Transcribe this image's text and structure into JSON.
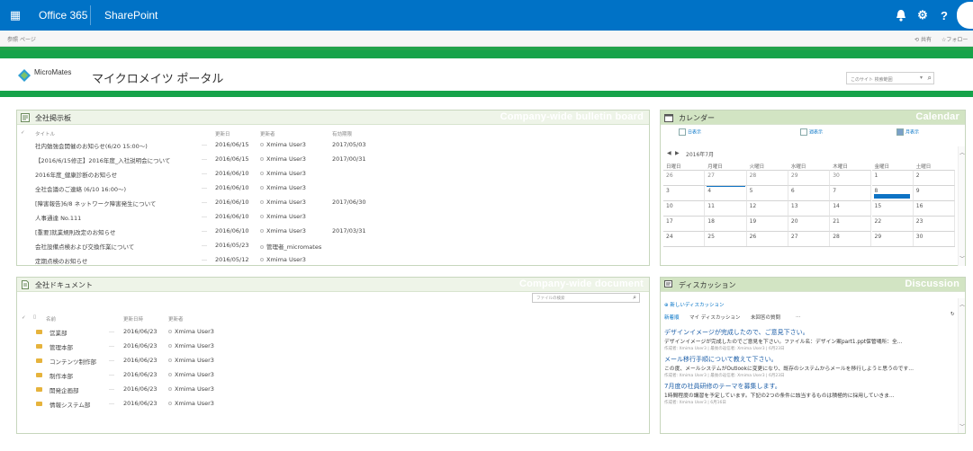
{
  "suite": {
    "office_label": "Office 365",
    "sharepoint_label": "SharePoint",
    "help_label": "?"
  },
  "ribbon": {
    "browse": "参照",
    "page": "ページ",
    "share": "共有",
    "follow": "フォロー"
  },
  "site": {
    "logo_text": "MicroMates",
    "title": "マイクロメイツ ポータル",
    "search_placeholder": "このサイト 検索範囲"
  },
  "bulletin": {
    "title": "全社掲示板",
    "watermark": "Company-wide bulletin board",
    "col_title": "タイトル",
    "col_modified": "更新日",
    "col_modified_by": "更新者",
    "col_expires": "有効期限",
    "rows": [
      {
        "title": "社内勉強会開催のお知らせ(6/20 15:00〜)",
        "date": "2016/06/15",
        "user": "Xmima User3",
        "expires": "2017/05/03"
      },
      {
        "title": "【2016/6/15修正】2016年度_入社説明会について",
        "date": "2016/06/15",
        "user": "Xmima User3",
        "expires": "2017/00/31"
      },
      {
        "title": "2016年度_健康診断のお知らせ",
        "date": "2016/06/10",
        "user": "Xmima User3",
        "expires": ""
      },
      {
        "title": "全社会議のご連絡 (6/10 16:00〜)",
        "date": "2016/06/10",
        "user": "Xmima User3",
        "expires": ""
      },
      {
        "title": "[障害報告]6/8 ネットワーク障害発生について",
        "date": "2016/06/10",
        "user": "Xmima User3",
        "expires": "2017/06/30"
      },
      {
        "title": "人事通達 No.111",
        "date": "2016/06/10",
        "user": "Xmima User3",
        "expires": ""
      },
      {
        "title": "[重要]就業規則改定のお知らせ",
        "date": "2016/06/10",
        "user": "Xmima User3",
        "expires": "2017/03/31"
      },
      {
        "title": "会社設備点検および交換作業について",
        "date": "2016/05/23",
        "user": "管理者_micromates",
        "expires": ""
      },
      {
        "title": "定期点検のお知らせ",
        "date": "2016/05/12",
        "user": "Xmima User3",
        "expires": ""
      }
    ]
  },
  "documents": {
    "title": "全社ドキュメント",
    "watermark": "Company-wide document",
    "search_placeholder": "ファイルの検索",
    "col_name": "名前",
    "col_modified": "更新日時",
    "col_modified_by": "更新者",
    "rows": [
      {
        "name": "営業部",
        "date": "2016/06/23",
        "user": "Xmima User3"
      },
      {
        "name": "管理本部",
        "date": "2016/06/23",
        "user": "Xmima User3"
      },
      {
        "name": "コンテンツ制作部",
        "date": "2016/06/23",
        "user": "Xmima User3"
      },
      {
        "name": "制作本部",
        "date": "2016/06/23",
        "user": "Xmima User3"
      },
      {
        "name": "開発企画部",
        "date": "2016/06/23",
        "user": "Xmima User3"
      },
      {
        "name": "情報システム部",
        "date": "2016/06/23",
        "user": "Xmima User3"
      }
    ]
  },
  "calendar": {
    "title": "カレンダー",
    "watermark": "Calendar",
    "view_day": "日表示",
    "view_week": "週表示",
    "view_month": "月表示",
    "month_label": "2016年7月",
    "weekdays": [
      "日曜日",
      "月曜日",
      "火曜日",
      "水曜日",
      "木曜日",
      "金曜日",
      "土曜日"
    ],
    "weeks": [
      [
        "26",
        "27",
        "28",
        "29",
        "30",
        "1",
        "2"
      ],
      [
        "3",
        "4",
        "5",
        "6",
        "7",
        "8",
        "9"
      ],
      [
        "10",
        "11",
        "12",
        "13",
        "14",
        "15",
        "16"
      ],
      [
        "17",
        "18",
        "19",
        "20",
        "21",
        "22",
        "23"
      ],
      [
        "24",
        "25",
        "26",
        "27",
        "28",
        "29",
        "30"
      ]
    ]
  },
  "discussion": {
    "title": "ディスカッション",
    "watermark": "Discussion",
    "new_label": "新しいディスカッション",
    "tab_latest": "新着順",
    "tab_mine": "マイ ディスカッション",
    "tab_unanswered": "未回答の質問",
    "tab_more": "…",
    "posts": [
      {
        "title": "デザインイメージが完成したので、ご意見下さい。",
        "body": "デザインイメージが完成したのでご意見を下さい。ファイル名：デザイン案part1.ppt保管場所：全…",
        "meta": "作成者: Xmima User3 | 最後の返信者: Xmima User3 | 6月23日"
      },
      {
        "title": "メール移行手順について教えて下さい。",
        "body": "この度、メールシステムがOutlookに変更になり、既存のシステムからメールを移行しようと思うのです…",
        "meta": "作成者: Xmima User3 | 最後の返信者: Xmima User3 | 6月23日"
      },
      {
        "title": "7月度の社員研修のテーマを募集します。",
        "body": "1時間程度の講習を予定しています。下記の2つの条件に該当するものは積極的に採用していきま…",
        "meta": "作成者: Xmima User3 | 6月16日"
      }
    ]
  }
}
